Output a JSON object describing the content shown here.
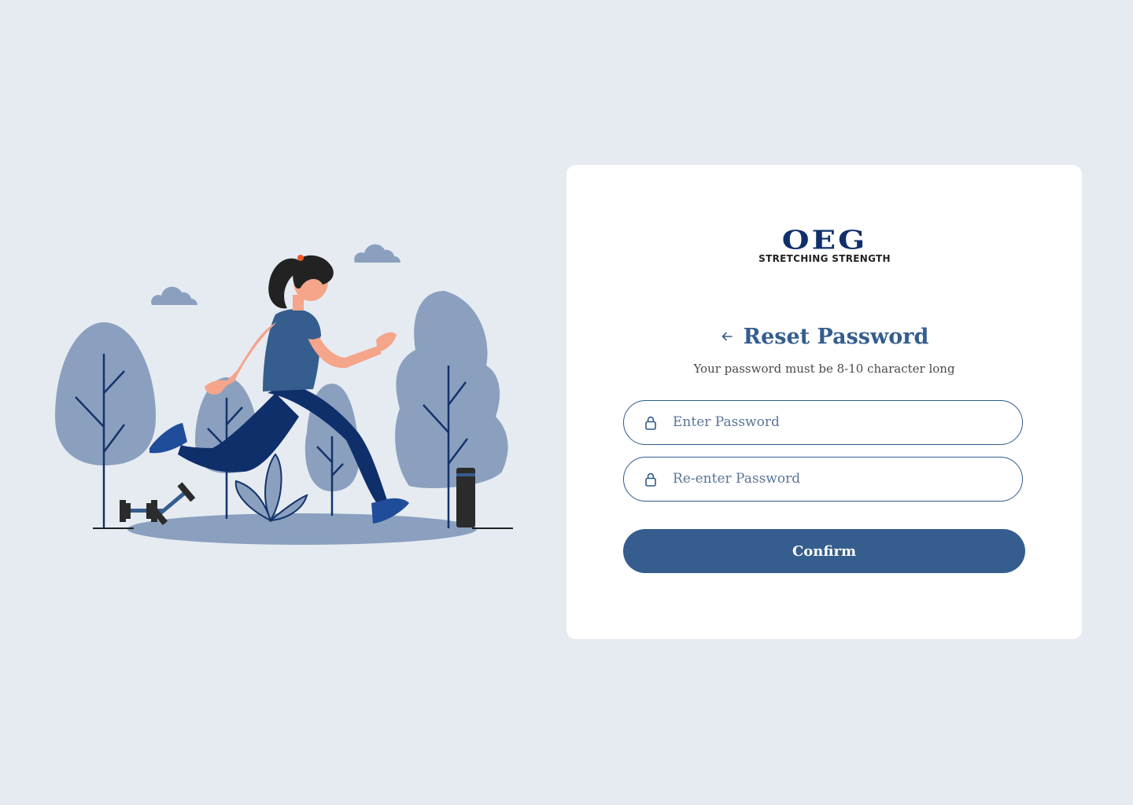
{
  "brand": {
    "logo_word": "OEG",
    "tagline": "STRETCHING STRENGTH"
  },
  "reset": {
    "title": "Reset Password",
    "subtitle": "Your password must be 8-10 character long",
    "password_placeholder": "Enter Password",
    "reenter_placeholder": "Re-enter Password",
    "confirm_label": "Confirm"
  },
  "icons": {
    "back": "arrow-left-icon",
    "lock": "lock-icon"
  },
  "colors": {
    "background": "#e6ebf2",
    "card": "#ffffff",
    "accent": "#355d8e",
    "brand_navy": "#0f2f6b"
  }
}
